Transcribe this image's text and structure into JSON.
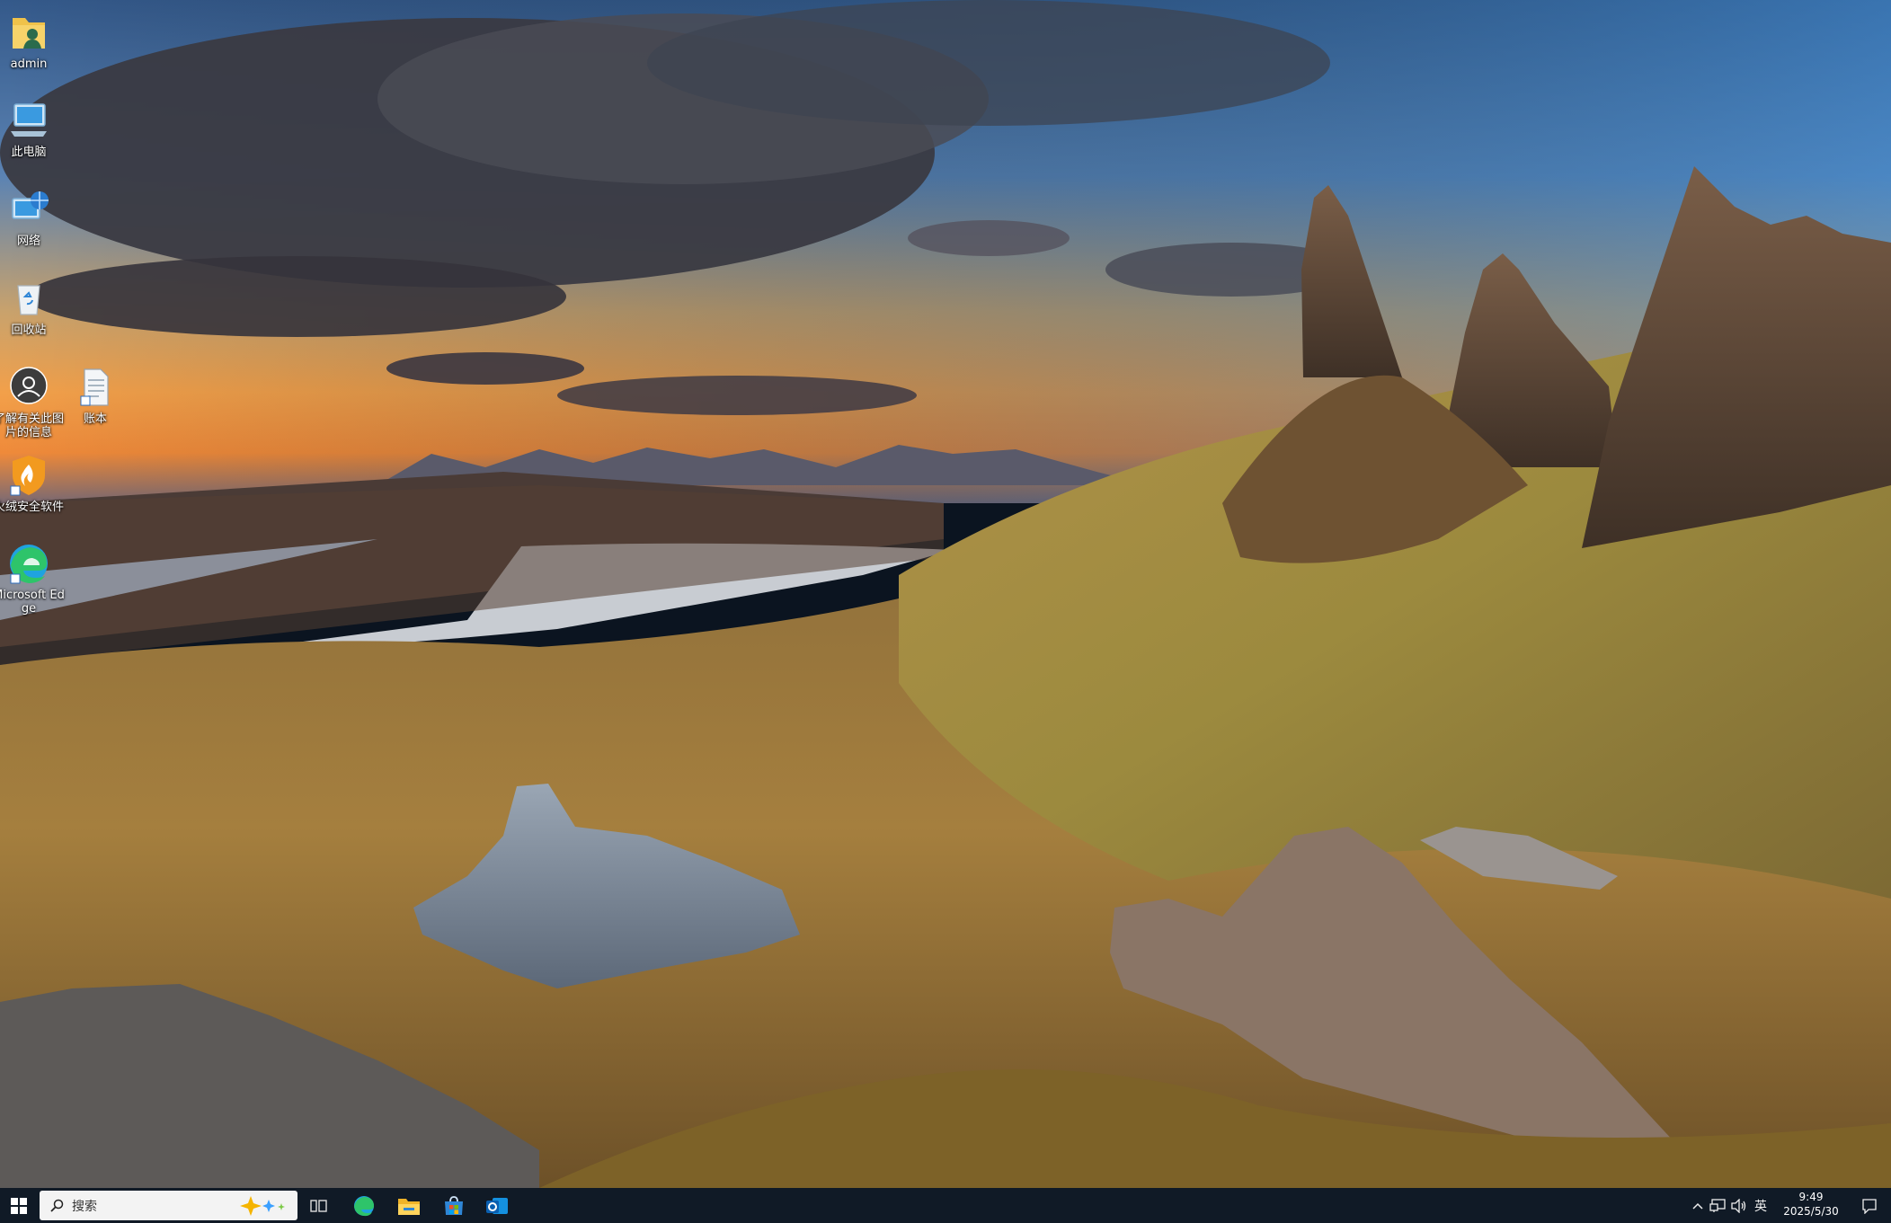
{
  "desktop": {
    "icons": [
      {
        "label": "admin",
        "icon": "user-folder-icon"
      },
      {
        "label": "此电脑",
        "icon": "computer-icon"
      },
      {
        "label": "网络",
        "icon": "network-icon"
      },
      {
        "label": "回收站",
        "icon": "recycle-bin-icon"
      },
      {
        "label": "了解有关此图片的信息",
        "icon": "camera-info-icon"
      },
      {
        "label": "账本",
        "icon": "document-icon"
      },
      {
        "label": "火绒安全软件",
        "icon": "huorong-shield-icon"
      },
      {
        "label": "Microsoft Edge",
        "icon": "edge-icon"
      }
    ]
  },
  "taskbar": {
    "search_placeholder": "搜索",
    "apps": [
      "task-view",
      "microsoft-edge",
      "file-explorer",
      "microsoft-store",
      "outlook"
    ],
    "tray": {
      "ime": "英",
      "time": "9:49",
      "date": "2025/5/30"
    }
  },
  "colors": {
    "taskbar_bg": "#101a26",
    "accent": "#0078d4"
  }
}
